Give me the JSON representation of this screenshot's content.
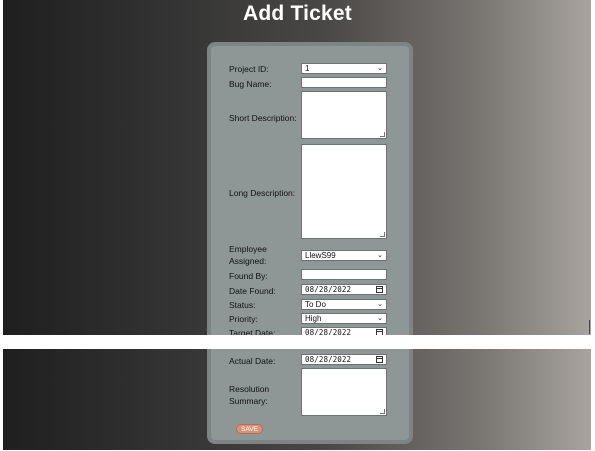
{
  "page": {
    "title": "Add Ticket"
  },
  "form": {
    "project_id": {
      "label": "Project ID:",
      "value": "1"
    },
    "bug_name": {
      "label": "Bug Name:",
      "value": ""
    },
    "short_description": {
      "label": "Short Description:",
      "value": ""
    },
    "long_description": {
      "label": "Long Description:",
      "value": ""
    },
    "employee_assigned": {
      "label_line1": "Employee",
      "label_line2": "Assigned:",
      "value": "LlewS99"
    },
    "found_by": {
      "label": "Found By:",
      "value": ""
    },
    "date_found": {
      "label": "Date Found:",
      "value": "08/28/2022"
    },
    "status": {
      "label": "Status:",
      "value": "To Do"
    },
    "priority": {
      "label": "Priority:",
      "value": "High"
    },
    "target_date": {
      "label": "Target Date:",
      "value": "08/28/2022"
    },
    "actual_date": {
      "label": "Actual Date:",
      "value": "08/28/2022"
    },
    "resolution_summary": {
      "label_line1": "Resolution",
      "label_line2": "Summary:",
      "value": ""
    },
    "save_label": "SAVE"
  },
  "icons": {
    "dropdown": "chevron-down-icon",
    "calendar": "calendar-icon",
    "resize": "resize-handle-icon"
  },
  "colors": {
    "card_background": "#8f9696",
    "save_button": "#d89479"
  }
}
